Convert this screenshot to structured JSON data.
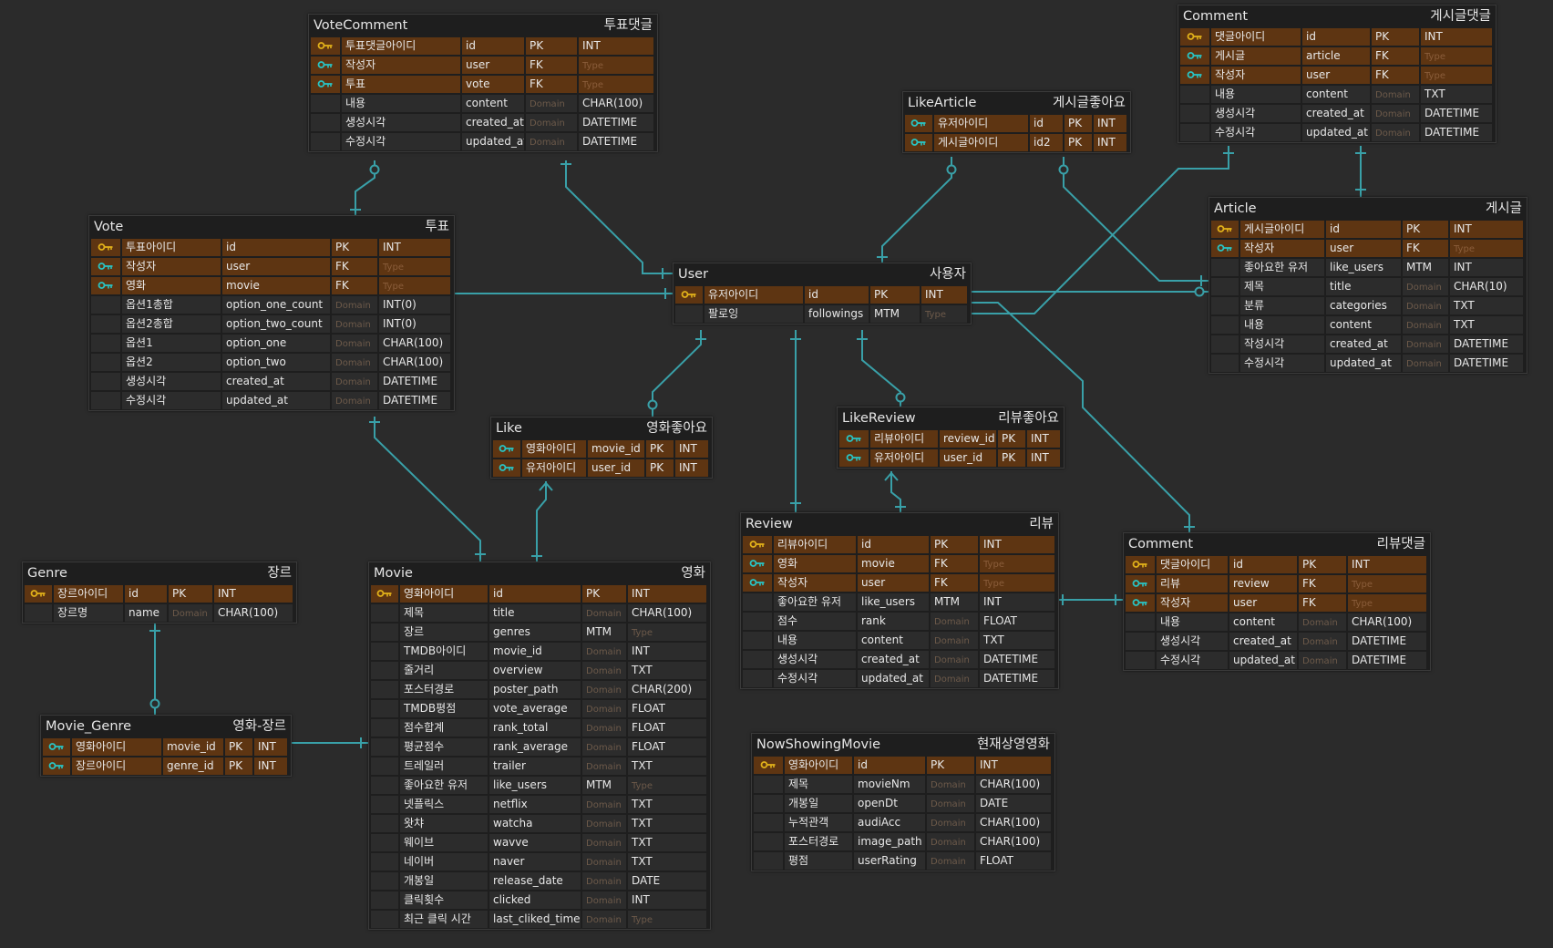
{
  "placeholders": {
    "domain": "Domain",
    "type": "Type"
  },
  "colors": {
    "background": "#2b2b2b",
    "table_bg": "#1e1e1e",
    "key_row": "#5e3512",
    "line": "#39a0a8",
    "pk_icon": "#e0b01a",
    "fk_icon": "#29c3c3"
  },
  "entities": [
    {
      "id": "votecomment",
      "physical": "VoteComment",
      "logical": "투표댓글",
      "rows": [
        {
          "key": "pk",
          "logical": "투표댓글아이디",
          "physical": "id",
          "domain": "PK",
          "type": "INT"
        },
        {
          "key": "fk",
          "logical": "작성자",
          "physical": "user",
          "domain": "FK",
          "type": ""
        },
        {
          "key": "fk",
          "logical": "투표",
          "physical": "vote",
          "domain": "FK",
          "type": ""
        },
        {
          "key": "",
          "logical": "내용",
          "physical": "content",
          "domain": "",
          "type": "CHAR(100)"
        },
        {
          "key": "",
          "logical": "생성시각",
          "physical": "created_at",
          "domain": "",
          "type": "DATETIME"
        },
        {
          "key": "",
          "logical": "수정시각",
          "physical": "updated_at",
          "domain": "",
          "type": "DATETIME"
        }
      ]
    },
    {
      "id": "vote",
      "physical": "Vote",
      "logical": "투표",
      "rows": [
        {
          "key": "pk",
          "logical": "투표아이디",
          "physical": "id",
          "domain": "PK",
          "type": "INT"
        },
        {
          "key": "fk",
          "logical": "작성자",
          "physical": "user",
          "domain": "FK",
          "type": ""
        },
        {
          "key": "fk",
          "logical": "영화",
          "physical": "movie",
          "domain": "FK",
          "type": ""
        },
        {
          "key": "",
          "logical": "옵션1총합",
          "physical": "option_one_count",
          "domain": "",
          "type": "INT(0)"
        },
        {
          "key": "",
          "logical": "옵션2총합",
          "physical": "option_two_count",
          "domain": "",
          "type": "INT(0)"
        },
        {
          "key": "",
          "logical": "옵션1",
          "physical": "option_one",
          "domain": "",
          "type": "CHAR(100)"
        },
        {
          "key": "",
          "logical": "옵션2",
          "physical": "option_two",
          "domain": "",
          "type": "CHAR(100)"
        },
        {
          "key": "",
          "logical": "생성시각",
          "physical": "created_at",
          "domain": "",
          "type": "DATETIME"
        },
        {
          "key": "",
          "logical": "수정시각",
          "physical": "updated_at",
          "domain": "",
          "type": "DATETIME"
        }
      ]
    },
    {
      "id": "user",
      "physical": "User",
      "logical": "사용자",
      "rows": [
        {
          "key": "pk",
          "logical": "유저아이디",
          "physical": "id",
          "domain": "PK",
          "type": "INT"
        },
        {
          "key": "",
          "logical": "팔로잉",
          "physical": "followings",
          "domain": "MTM",
          "type": ""
        }
      ]
    },
    {
      "id": "likearticle",
      "physical": "LikeArticle",
      "logical": "게시글좋아요",
      "rows": [
        {
          "key": "pkfk",
          "logical": "유저아이디",
          "physical": "id",
          "domain": "PK",
          "type": "INT"
        },
        {
          "key": "pkfk",
          "logical": "게시글아이디",
          "physical": "id2",
          "domain": "PK",
          "type": "INT"
        }
      ]
    },
    {
      "id": "comment_article",
      "physical": "Comment",
      "logical": "게시글댓글",
      "rows": [
        {
          "key": "pk",
          "logical": "댓글아이디",
          "physical": "id",
          "domain": "PK",
          "type": "INT"
        },
        {
          "key": "fk",
          "logical": "게시글",
          "physical": "article",
          "domain": "FK",
          "type": ""
        },
        {
          "key": "fk",
          "logical": "작성자",
          "physical": "user",
          "domain": "FK",
          "type": ""
        },
        {
          "key": "",
          "logical": "내용",
          "physical": "content",
          "domain": "",
          "type": "TXT"
        },
        {
          "key": "",
          "logical": "생성시각",
          "physical": "created_at",
          "domain": "",
          "type": "DATETIME"
        },
        {
          "key": "",
          "logical": "수정시각",
          "physical": "updated_at",
          "domain": "",
          "type": "DATETIME"
        }
      ]
    },
    {
      "id": "article",
      "physical": "Article",
      "logical": "게시글",
      "rows": [
        {
          "key": "pk",
          "logical": "게시글아이디",
          "physical": "id",
          "domain": "PK",
          "type": "INT"
        },
        {
          "key": "fk",
          "logical": "작성자",
          "physical": "user",
          "domain": "FK",
          "type": ""
        },
        {
          "key": "",
          "logical": "좋아요한 유저",
          "physical": "like_users",
          "domain": "MTM",
          "type": "INT"
        },
        {
          "key": "",
          "logical": "제목",
          "physical": "title",
          "domain": "",
          "type": "CHAR(10)"
        },
        {
          "key": "",
          "logical": "분류",
          "physical": "categories",
          "domain": "",
          "type": "TXT"
        },
        {
          "key": "",
          "logical": "내용",
          "physical": "content",
          "domain": "",
          "type": "TXT"
        },
        {
          "key": "",
          "logical": "작성시각",
          "physical": "created_at",
          "domain": "",
          "type": "DATETIME"
        },
        {
          "key": "",
          "logical": "수정시각",
          "physical": "updated_at",
          "domain": "",
          "type": "DATETIME"
        }
      ]
    },
    {
      "id": "like",
      "physical": "Like",
      "logical": "영화좋아요",
      "rows": [
        {
          "key": "pkfk",
          "logical": "영화아이디",
          "physical": "movie_id",
          "domain": "PK",
          "type": "INT"
        },
        {
          "key": "pkfk",
          "logical": "유저아이디",
          "physical": "user_id",
          "domain": "PK",
          "type": "INT"
        }
      ]
    },
    {
      "id": "likereview",
      "physical": "LikeReview",
      "logical": "리뷰좋아요",
      "rows": [
        {
          "key": "pkfk",
          "logical": "리뷰아이디",
          "physical": "review_id",
          "domain": "PK",
          "type": "INT"
        },
        {
          "key": "pkfk",
          "logical": "유저아이디",
          "physical": "user_id",
          "domain": "PK",
          "type": "INT"
        }
      ]
    },
    {
      "id": "review",
      "physical": "Review",
      "logical": "리뷰",
      "rows": [
        {
          "key": "pk",
          "logical": "리뷰아이디",
          "physical": "id",
          "domain": "PK",
          "type": "INT"
        },
        {
          "key": "fk",
          "logical": "영화",
          "physical": "movie",
          "domain": "FK",
          "type": ""
        },
        {
          "key": "fk",
          "logical": "작성자",
          "physical": "user",
          "domain": "FK",
          "type": ""
        },
        {
          "key": "",
          "logical": "좋아요한 유저",
          "physical": "like_users",
          "domain": "MTM",
          "type": "INT"
        },
        {
          "key": "",
          "logical": "점수",
          "physical": "rank",
          "domain": "",
          "type": "FLOAT"
        },
        {
          "key": "",
          "logical": "내용",
          "physical": "content",
          "domain": "",
          "type": "TXT"
        },
        {
          "key": "",
          "logical": "생성시각",
          "physical": "created_at",
          "domain": "",
          "type": "DATETIME"
        },
        {
          "key": "",
          "logical": "수정시각",
          "physical": "updated_at",
          "domain": "",
          "type": "DATETIME"
        }
      ]
    },
    {
      "id": "comment_review",
      "physical": "Comment",
      "logical": "리뷰댓글",
      "rows": [
        {
          "key": "pk",
          "logical": "댓글아이디",
          "physical": "id",
          "domain": "PK",
          "type": "INT"
        },
        {
          "key": "fk",
          "logical": "리뷰",
          "physical": "review",
          "domain": "FK",
          "type": ""
        },
        {
          "key": "fk",
          "logical": "작성자",
          "physical": "user",
          "domain": "FK",
          "type": ""
        },
        {
          "key": "",
          "logical": "내용",
          "physical": "content",
          "domain": "",
          "type": "CHAR(100)"
        },
        {
          "key": "",
          "logical": "생성시각",
          "physical": "created_at",
          "domain": "",
          "type": "DATETIME"
        },
        {
          "key": "",
          "logical": "수정시각",
          "physical": "updated_at",
          "domain": "",
          "type": "DATETIME"
        }
      ]
    },
    {
      "id": "genre",
      "physical": "Genre",
      "logical": "장르",
      "rows": [
        {
          "key": "pk",
          "logical": "장르아이디",
          "physical": "id",
          "domain": "PK",
          "type": "INT"
        },
        {
          "key": "",
          "logical": "장르명",
          "physical": "name",
          "domain": "",
          "type": "CHAR(100)"
        }
      ]
    },
    {
      "id": "movie",
      "physical": "Movie",
      "logical": "영화",
      "rows": [
        {
          "key": "pk",
          "logical": "영화아이디",
          "physical": "id",
          "domain": "PK",
          "type": "INT"
        },
        {
          "key": "",
          "logical": "제목",
          "physical": "title",
          "domain": "",
          "type": "CHAR(100)"
        },
        {
          "key": "",
          "logical": "장르",
          "physical": "genres",
          "domain": "MTM",
          "type": ""
        },
        {
          "key": "",
          "logical": "TMDB아이디",
          "physical": "movie_id",
          "domain": "",
          "type": "INT"
        },
        {
          "key": "",
          "logical": "줄거리",
          "physical": "overview",
          "domain": "",
          "type": "TXT"
        },
        {
          "key": "",
          "logical": "포스터경로",
          "physical": "poster_path",
          "domain": "",
          "type": "CHAR(200)"
        },
        {
          "key": "",
          "logical": "TMDB평점",
          "physical": "vote_average",
          "domain": "",
          "type": "FLOAT"
        },
        {
          "key": "",
          "logical": "점수합계",
          "physical": "rank_total",
          "domain": "",
          "type": "FLOAT"
        },
        {
          "key": "",
          "logical": "평균점수",
          "physical": "rank_average",
          "domain": "",
          "type": "FLOAT"
        },
        {
          "key": "",
          "logical": "트레일러",
          "physical": "trailer",
          "domain": "",
          "type": "TXT"
        },
        {
          "key": "",
          "logical": "좋아요한 유저",
          "physical": "like_users",
          "domain": "MTM",
          "type": ""
        },
        {
          "key": "",
          "logical": "넷플릭스",
          "physical": "netflix",
          "domain": "",
          "type": "TXT"
        },
        {
          "key": "",
          "logical": "왓챠",
          "physical": "watcha",
          "domain": "",
          "type": "TXT"
        },
        {
          "key": "",
          "logical": "웨이브",
          "physical": "wavve",
          "domain": "",
          "type": "TXT"
        },
        {
          "key": "",
          "logical": "네이버",
          "physical": "naver",
          "domain": "",
          "type": "TXT"
        },
        {
          "key": "",
          "logical": "개봉일",
          "physical": "release_date",
          "domain": "",
          "type": "DATE"
        },
        {
          "key": "",
          "logical": "클릭횟수",
          "physical": "clicked",
          "domain": "",
          "type": "INT"
        },
        {
          "key": "",
          "logical": "최근 클릭 시간",
          "physical": "last_cliked_time",
          "domain": "",
          "type": ""
        }
      ]
    },
    {
      "id": "movie_genre",
      "physical": "Movie_Genre",
      "logical": "영화-장르",
      "rows": [
        {
          "key": "pkfk",
          "logical": "영화아이디",
          "physical": "movie_id",
          "domain": "PK",
          "type": "INT"
        },
        {
          "key": "pkfk",
          "logical": "장르아이디",
          "physical": "genre_id",
          "domain": "PK",
          "type": "INT"
        }
      ]
    },
    {
      "id": "nowshowing",
      "physical": "NowShowingMovie",
      "logical": "현재상영영화",
      "rows": [
        {
          "key": "pk",
          "logical": "영화아이디",
          "physical": "id",
          "domain": "PK",
          "type": "INT"
        },
        {
          "key": "",
          "logical": "제목",
          "physical": "movieNm",
          "domain": "",
          "type": "CHAR(100)"
        },
        {
          "key": "",
          "logical": "개봉일",
          "physical": "openDt",
          "domain": "",
          "type": "DATE"
        },
        {
          "key": "",
          "logical": "누적관객",
          "physical": "audiAcc",
          "domain": "",
          "type": "CHAR(100)"
        },
        {
          "key": "",
          "logical": "포스터경로",
          "physical": "image_path",
          "domain": "",
          "type": "CHAR(100)"
        },
        {
          "key": "",
          "logical": "평점",
          "physical": "userRating",
          "domain": "",
          "type": "FLOAT"
        }
      ]
    }
  ]
}
